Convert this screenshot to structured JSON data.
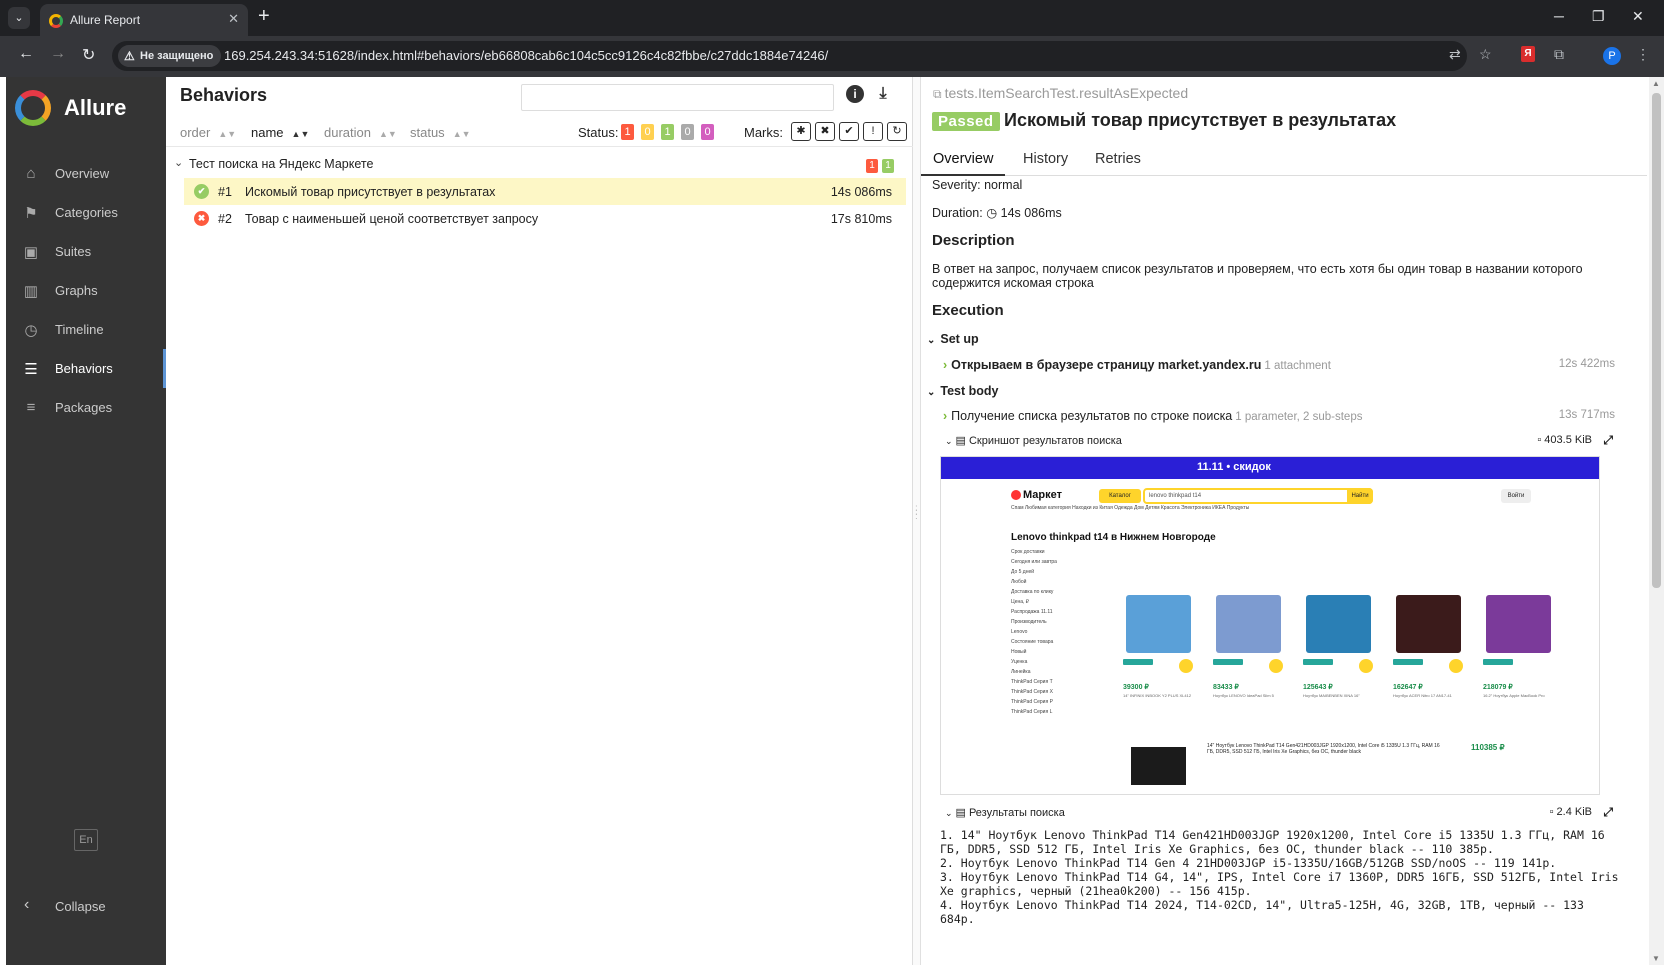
{
  "browser": {
    "tab_title": "Allure Report",
    "new_tab_icon": "+",
    "not_secure_label": "Не защищено",
    "url": "169.254.243.34:51628/index.html#behaviors/eb66808cab6c104c5cc9126c4c82fbbe/c27ddc1884e74246/",
    "profile_initial": "P",
    "yandex_initial": "Я"
  },
  "sidebar": {
    "brand": "Allure",
    "items": [
      {
        "label": "Overview",
        "icon": "home-icon"
      },
      {
        "label": "Categories",
        "icon": "flag-icon"
      },
      {
        "label": "Suites",
        "icon": "briefcase-icon"
      },
      {
        "label": "Graphs",
        "icon": "bar-chart-icon"
      },
      {
        "label": "Timeline",
        "icon": "clock-icon"
      },
      {
        "label": "Behaviors",
        "icon": "list-icon"
      },
      {
        "label": "Packages",
        "icon": "align-left-icon"
      }
    ],
    "active_item": "Behaviors",
    "language": "En",
    "collapse_label": "Collapse"
  },
  "tree": {
    "title": "Behaviors",
    "search_placeholder": "",
    "sort": [
      {
        "label": "order",
        "active": false
      },
      {
        "label": "name",
        "active": true
      },
      {
        "label": "duration",
        "active": false
      },
      {
        "label": "status",
        "active": false
      }
    ],
    "status_label": "Status:",
    "status_counts": [
      {
        "value": "1",
        "color": "#fd5a3e"
      },
      {
        "value": "0",
        "color": "#ffd050"
      },
      {
        "value": "1",
        "color": "#97cc64"
      },
      {
        "value": "0",
        "color": "#aaaaaa"
      },
      {
        "value": "0",
        "color": "#d35ebe"
      }
    ],
    "marks_label": "Marks:",
    "group": {
      "name": "Тест поиска на Яндекс Маркете",
      "failed": "1",
      "passed": "1"
    },
    "rows": [
      {
        "num": "#1",
        "name": "Искомый товар присутствует в результатах",
        "duration": "14s 086ms",
        "status": "passed"
      },
      {
        "num": "#2",
        "name": "Товар с наименьшей ценой соответствует запросу",
        "duration": "17s 810ms",
        "status": "failed"
      }
    ]
  },
  "detail": {
    "full_name": "tests.ItemSearchTest.resultAsExpected",
    "status_badge": "Passed",
    "title": "Искомый товар присутствует в результатах",
    "tabs": [
      "Overview",
      "History",
      "Retries"
    ],
    "active_tab": "Overview",
    "severity": "Severity: normal",
    "duration_label": "Duration:",
    "duration_value": "14s 086ms",
    "description_heading": "Description",
    "description": "В ответ на запрос, получаем список результатов и проверяем, что есть хотя бы один товар в названии которого содержится искомая строка",
    "execution_heading": "Execution",
    "setup_label": "Set up",
    "setup_step": {
      "name": "Открываем в браузере страницу market.yandex.ru",
      "meta": "1 attachment",
      "duration": "12s 422ms"
    },
    "testbody_label": "Test body",
    "body_step": {
      "name": "Получение списка результатов по строке поиска",
      "meta": "1 parameter, 2 sub-steps",
      "duration": "13s 717ms"
    },
    "attachment1": {
      "name": "Скриншот результатов поиска",
      "size": "403.5 KiB"
    },
    "attachment2": {
      "name": "Результаты поиска",
      "size": "2.4 KiB"
    },
    "results_text": "1. 14\" Ноутбук Lenovo ThinkPad T14 Gen421HD003JGP 1920x1200, Intel Core i5 1335U 1.3 ГГц, RAM 16 ГБ, DDR5, SSD 512 ГБ, Intel Iris Xe Graphics, без ОС, thunder black -- 110 385р.\n2. Ноутбук Lenovo ThinkPad T14 Gen 4 21HD003JGP i5-1335U/16GB/512GB SSD/noOS -- 119 141р.\n3. Ноутбук Lenovo ThinkPad T14 G4, 14\", IPS, Intel Core i7 1360P, DDR5 16ГБ, SSD 512ГБ, Intel Iris Xe graphics, черный (21hea0k200) -- 156 415р.\n4. Ноутбук Lenovo ThinkPad T14 2024, T14-02CD, 14\", Ultra5-125H, 4G, 32GB, 1TB, черный -- 133 684р."
  },
  "screenshot": {
    "promo": "11.11 • скидок",
    "logo": "Маркет",
    "catalog": "Каталог",
    "query": "lenovo thinkpad t14",
    "find": "Найти",
    "login": "Войти",
    "menu": "Спам   Любимая категория   Находки из Китая   Одежда   Дом   Детям   Красота   Электроника   ИКЕА   Продукты",
    "heading": "Lenovo thinkpad t14 в Нижнем Новгороде",
    "filters": "Срок доставки\nСегодня или завтра\nДо 5 дней\nЛюбой\nДоставка по клику\nЦена, ₽\nРаспродажа 11.11\nПроизводитель\nLenovo\nСостояние товара\nНовый\nУценка\nЛинейка\nThinkPad Серия T\nThinkPad Серия X\nThinkPad Серия P\nThinkPad Серия L",
    "cards": [
      {
        "price": "39300 ₽",
        "desc": "14\" INFINIX INBOOK Y2 PLUS XL412",
        "img_color": "#5aa0d8"
      },
      {
        "price": "83433 ₽",
        "desc": "Ноутбук LENOVO IdeaPad Slim 5",
        "img_color": "#7d9bd0"
      },
      {
        "price": "125643 ₽",
        "desc": "Ноутбук MAIBENBEN XINA 16\"",
        "img_color": "#2a7fb5"
      },
      {
        "price": "162647 ₽",
        "desc": "Ноутбук ACER Nitro 17 AN17-41",
        "img_color": "#3b1b1b"
      },
      {
        "price": "218079 ₽",
        "desc": "16.2\" Ноутбук Apple MacBook Pro",
        "img_color": "#7b3a9a"
      }
    ],
    "bottom_text": "14\" Ноутбук Lenovo ThinkPad T14 Gen421HD003JGP 1920x1200, Intel Core i5 1335U 1.3 ГГц, RAM 16 ГБ, DDR5, SSD 512 ГБ, Intel Iris Xe Graphics, без ОС, thunder black",
    "bottom_price": "110385 ₽"
  },
  "colors": {
    "sidebar_bg": "#343434",
    "accent_blue": "#5e95d5",
    "passed": "#97cc64",
    "failed": "#fd5a3e",
    "selected_row": "#fdf7c6"
  }
}
